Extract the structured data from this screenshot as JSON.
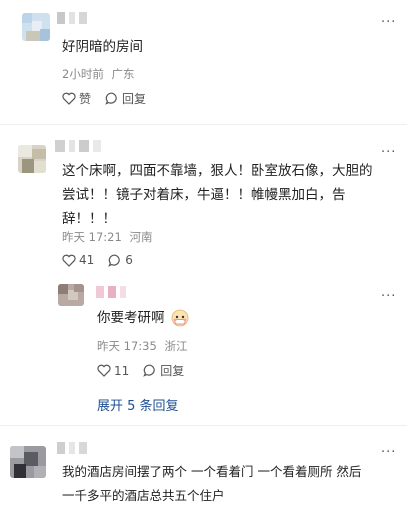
{
  "comments": [
    {
      "text": "好阴暗的房间",
      "time": "2小时前",
      "location": "广东",
      "like_label": "赞",
      "reply_label": "回复"
    },
    {
      "text_line1": "这个床啊，四面不靠墙，狠人！卧室放石像，大胆的",
      "text_line2": "尝试！！镜子对着床，牛逼！！帷幔黑加白，告",
      "text_line3": "辞！！！",
      "time": "昨天 17:21",
      "location": "河南",
      "like_count": "41",
      "reply_count": "6"
    },
    {
      "text": "你要考研啊",
      "time": "昨天 17:35",
      "location": "浙江",
      "like_count": "11",
      "reply_label": "回复",
      "expand_label": "展开 5 条回复"
    },
    {
      "text_line1": "我的酒店房间摆了两个 一个看着门 一个看着厕所 然后",
      "text_line2": "一千多平的酒店总共五个住户"
    }
  ],
  "more_icon": "···",
  "colors": {
    "link": "#1e4f91",
    "meta": "#8a8a8a"
  }
}
